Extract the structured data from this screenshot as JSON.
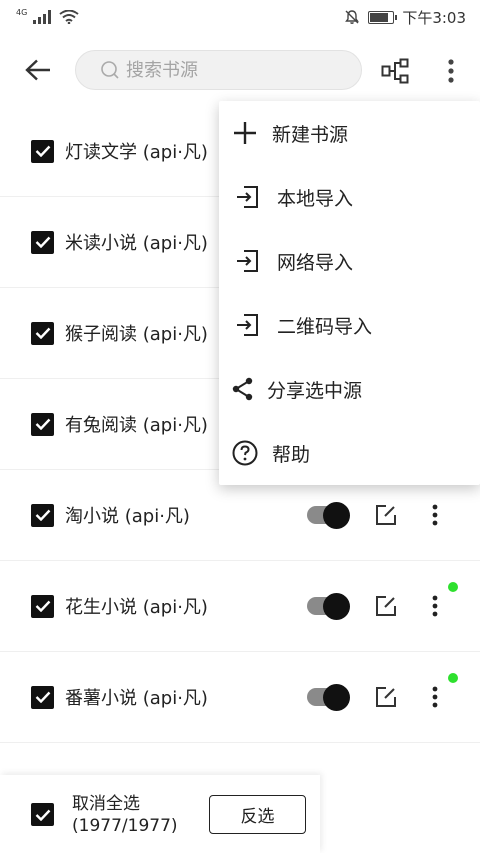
{
  "status_bar": {
    "network_type": "4G",
    "time": "下午3:03"
  },
  "search": {
    "placeholder": "搜索书源"
  },
  "sources": [
    {
      "name": "灯读文学 (api·凡)",
      "checked": true
    },
    {
      "name": "米读小说 (api·凡)",
      "checked": true
    },
    {
      "name": "猴子阅读 (api·凡)",
      "checked": true
    },
    {
      "name": "有兔阅读 (api·凡)",
      "checked": true
    },
    {
      "name": "淘小说 (api·凡)",
      "checked": true,
      "enabled": true
    },
    {
      "name": "花生小说 (api·凡)",
      "checked": true,
      "enabled": true
    },
    {
      "name": "番薯小说 (api·凡)",
      "checked": true,
      "enabled": true
    }
  ],
  "bottom_bar": {
    "select_all_label_line1": "取消全选",
    "select_all_label_line2": "(1977/1977)",
    "invert_label": "反选"
  },
  "menu": {
    "items": [
      {
        "label": "新建书源",
        "icon": "plus-icon"
      },
      {
        "label": "本地导入",
        "icon": "import-icon"
      },
      {
        "label": "网络导入",
        "icon": "import-icon"
      },
      {
        "label": "二维码导入",
        "icon": "import-icon"
      },
      {
        "label": "分享选中源",
        "icon": "share-icon"
      },
      {
        "label": "帮助",
        "icon": "help-icon"
      }
    ]
  },
  "colors": {
    "accent": "#111111",
    "status_dot": "#2ee02e",
    "switch_track": "#8a8a8a"
  }
}
